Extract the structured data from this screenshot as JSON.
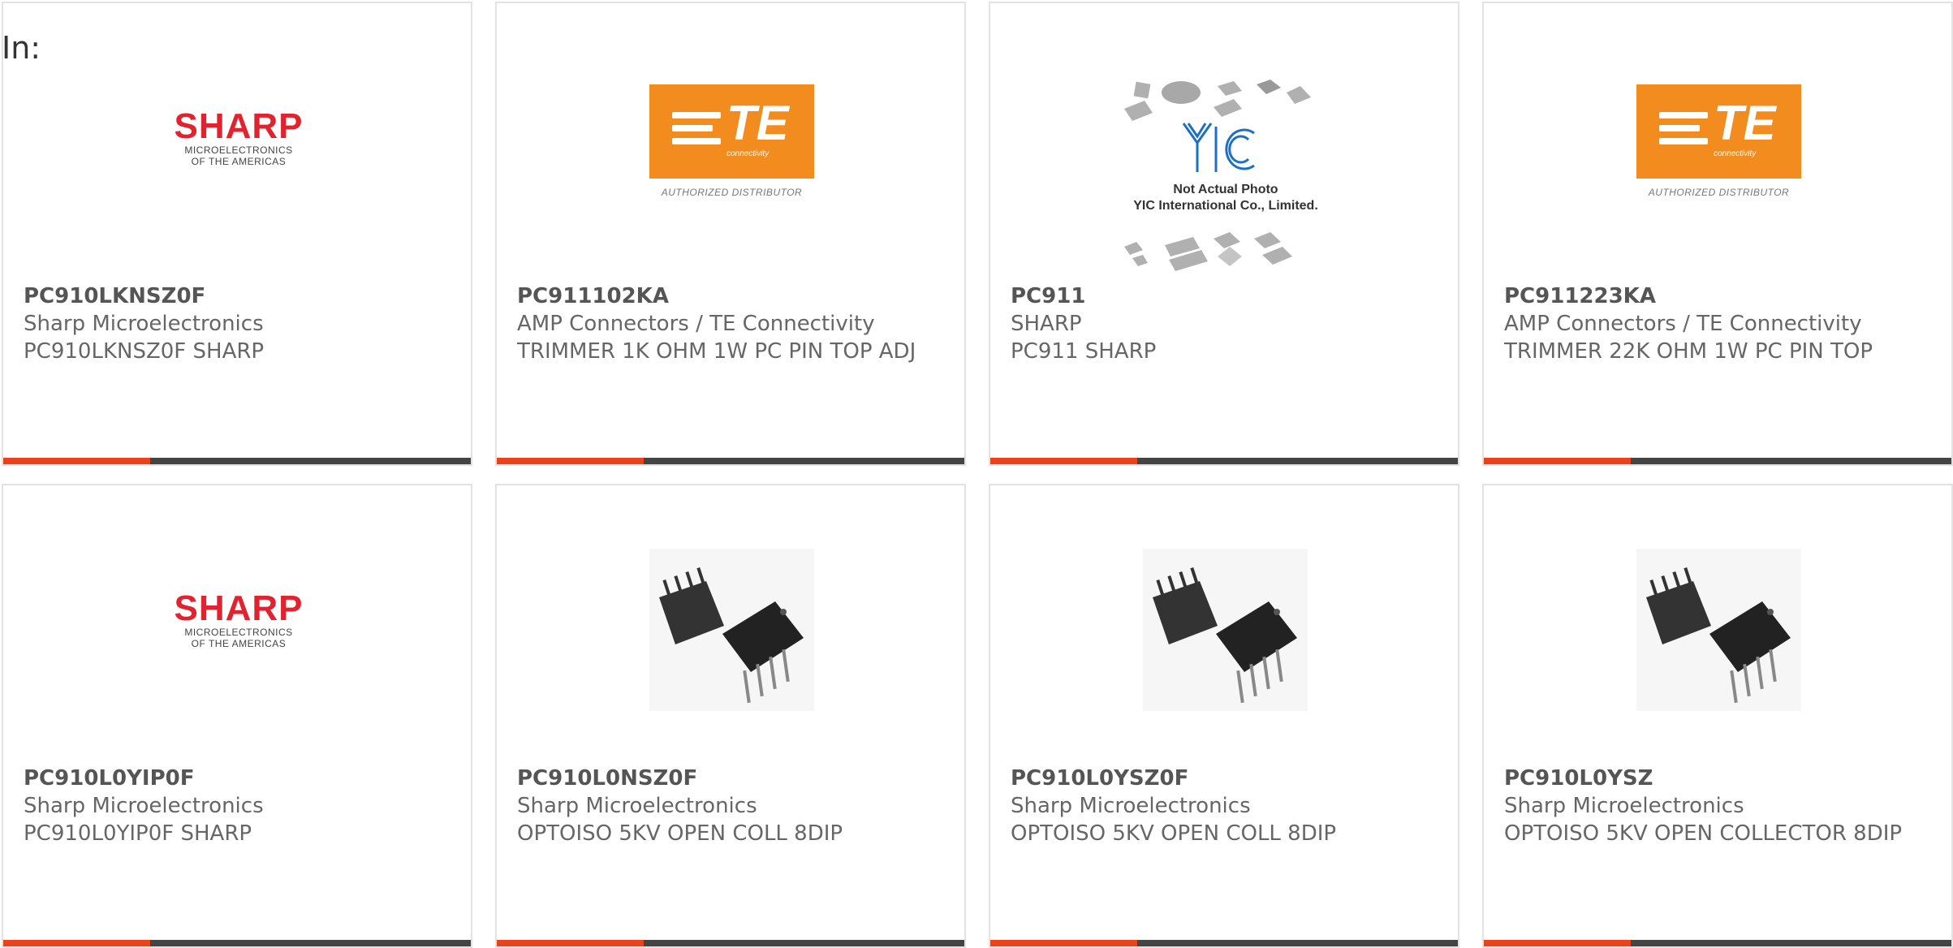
{
  "header": {
    "in_label": "In:"
  },
  "cards": [
    {
      "part_number": "PC910LKNSZ0F",
      "manufacturer": "Sharp Microelectronics",
      "description": "PC910LKNSZ0F SHARP",
      "image": "sharp-logo"
    },
    {
      "part_number": "PC911102KA",
      "manufacturer": "AMP Connectors / TE Connectivity",
      "description": "TRIMMER 1K OHM 1W PC PIN TOP ADJ",
      "image": "te-logo"
    },
    {
      "part_number": "PC911",
      "manufacturer": "SHARP",
      "description": "PC911 SHARP",
      "image": "yic-placeholder"
    },
    {
      "part_number": "PC911223KA",
      "manufacturer": "AMP Connectors / TE Connectivity",
      "description": "TRIMMER 22K OHM 1W PC PIN TOP",
      "image": "te-logo"
    },
    {
      "part_number": "PC910L0YIP0F",
      "manufacturer": "Sharp Microelectronics",
      "description": "PC910L0YIP0F SHARP",
      "image": "sharp-logo"
    },
    {
      "part_number": "PC910L0NSZ0F",
      "manufacturer": "Sharp Microelectronics",
      "description": "OPTOISO 5KV OPEN COLL 8DIP",
      "image": "dip-chip"
    },
    {
      "part_number": "PC910L0YSZ0F",
      "manufacturer": "Sharp Microelectronics",
      "description": "OPTOISO 5KV OPEN COLL 8DIP",
      "image": "dip-chip"
    },
    {
      "part_number": "PC910L0YSZ",
      "manufacturer": "Sharp Microelectronics",
      "description": "OPTOISO 5KV OPEN COLLECTOR 8DIP",
      "image": "dip-chip"
    }
  ],
  "logos": {
    "sharp_word": "SHARP",
    "sharp_sub_1": "MICROELECTRONICS",
    "sharp_sub_2": "OF THE AMERICAS",
    "te_word": "TE",
    "te_conn": "connectivity",
    "te_auth": "AUTHORIZED DISTRIBUTOR",
    "yic_line_1": "Not Actual Photo",
    "yic_line_2": "YIC International Co., Limited."
  },
  "colors": {
    "accent": "#e8431d",
    "bar": "#444444",
    "sharp_red": "#e0232f",
    "te_orange": "#f28c1e"
  }
}
